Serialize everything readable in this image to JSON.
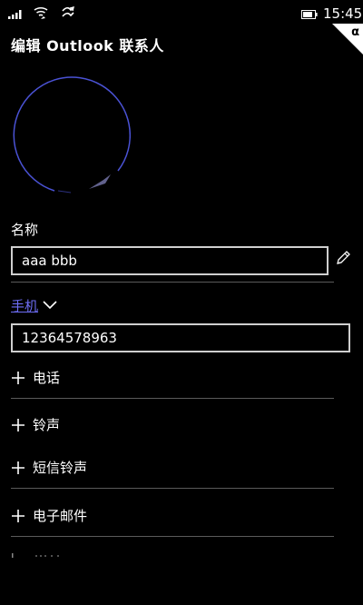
{
  "status_bar": {
    "time": "15:45",
    "icons": [
      "signal-icon",
      "wifi-icon",
      "data-transfer-icon",
      "battery-icon"
    ]
  },
  "corner_tag": "α",
  "header": {
    "title": "编辑 Outlook 联系人"
  },
  "avatar": {
    "icon": "avatar-placeholder-icon",
    "ring_color": "#4a52d4"
  },
  "name_section": {
    "label": "名称",
    "value": "aaa bbb",
    "edit_icon": "pencil-icon"
  },
  "phone_section": {
    "type_label": "手机",
    "value": "12364578963",
    "link_color": "#6e6ef5"
  },
  "add_items": [
    {
      "label": "电话"
    },
    {
      "label": "铃声"
    },
    {
      "label": "短信铃声"
    },
    {
      "label": "电子邮件"
    }
  ],
  "colors": {
    "background": "#000000",
    "text": "#ffffff",
    "border": "#cfcfcf",
    "accent": "#6e6ef5"
  }
}
